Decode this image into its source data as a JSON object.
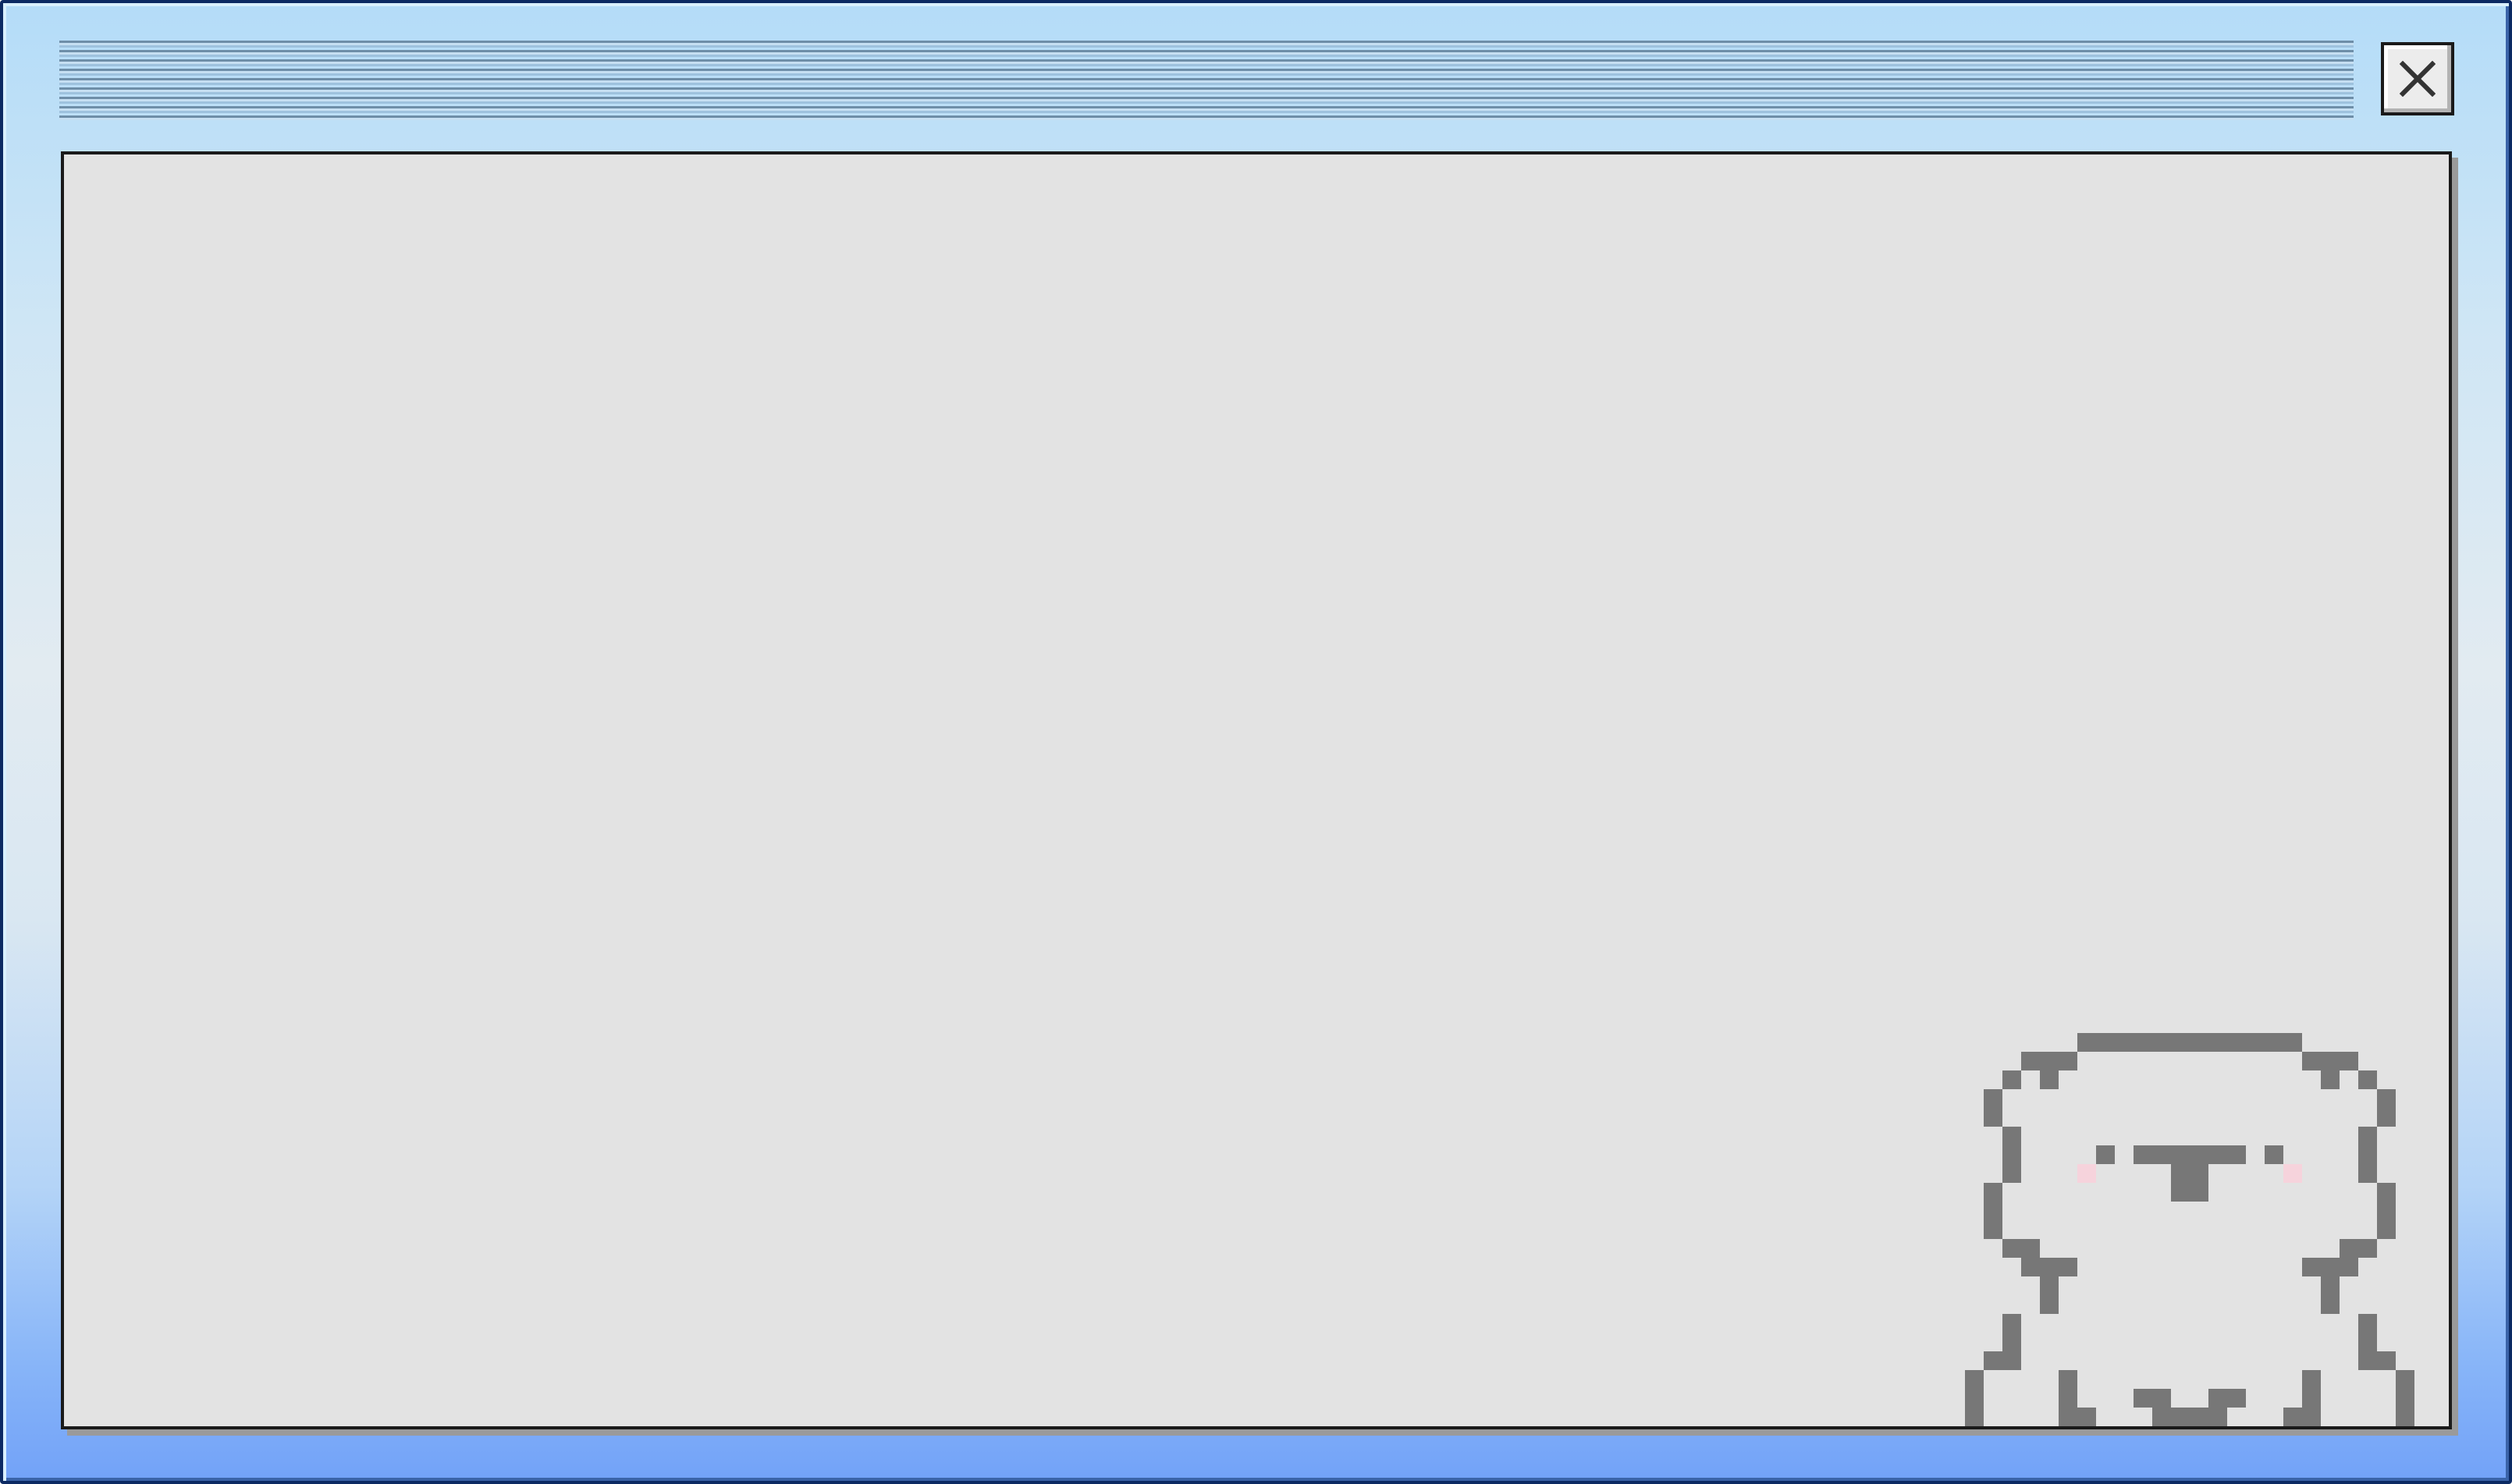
{
  "window": {
    "title": "",
    "close_icon": "close-icon",
    "accent_colors": {
      "frame_border": "#0c2a63",
      "frame_top": "#b4dcf8",
      "frame_bottom": "#72a2f8",
      "panel_background": "#e3e3e3"
    }
  },
  "content": {
    "mascot": {
      "icon": "pixel-bear-icon",
      "outline_color": "#777777",
      "blush_color": "#f6d3dc"
    }
  }
}
